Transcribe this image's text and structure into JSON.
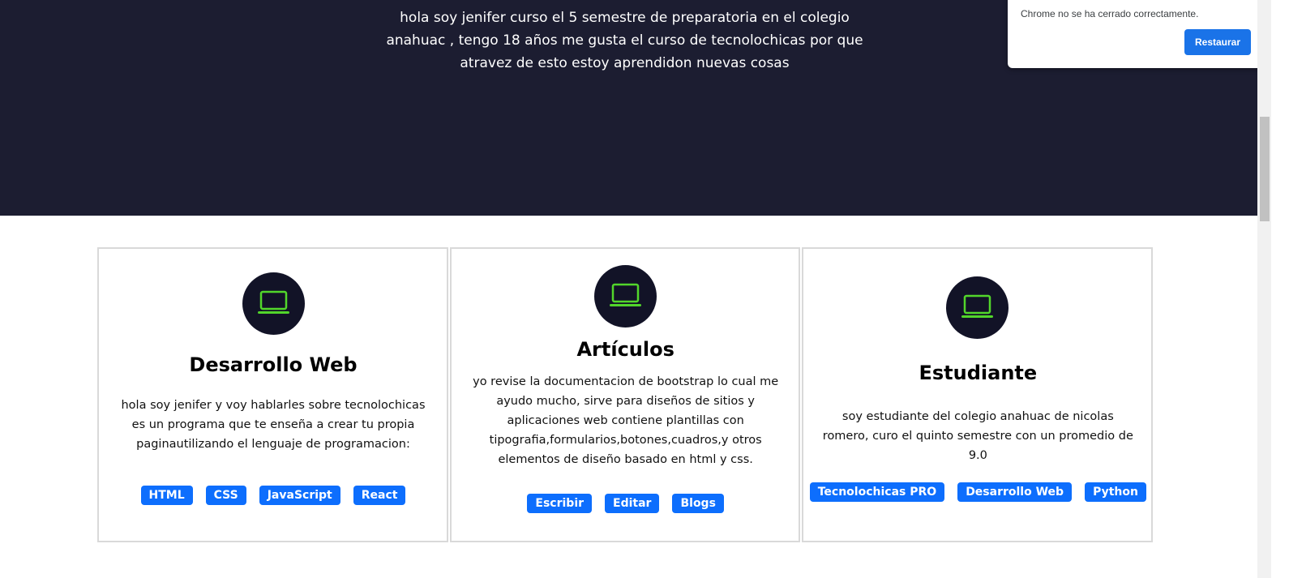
{
  "hero": {
    "intro": "hola soy jenifer curso el 5 semestre de preparatoria en el colegio anahuac , tengo 18 años me gusta el curso de tecnolochicas por que atravez de esto estoy aprendidon nuevas cosas"
  },
  "toast": {
    "message": "Chrome no se ha cerrado correctamente.",
    "button": "Restaurar"
  },
  "accent_color": "#0d6efd",
  "icon_color": "#52d62b",
  "cards": [
    {
      "icon": "laptop-icon",
      "title": "Desarrollo Web",
      "text": "hola soy jenifer y voy hablarles sobre tecnolochicas es un programa que te enseña a crear tu propia paginautilizando el lenguaje de programacion:",
      "badges": [
        "HTML",
        "CSS",
        "JavaScript",
        "React"
      ]
    },
    {
      "icon": "laptop-icon",
      "title": "Artículos",
      "text": "yo revise la documentacion de bootstrap lo cual me ayudo mucho, sirve para diseños de sitios y aplicaciones web contiene plantillas con tipografia,formularios,botones,cuadros,y otros elementos de diseño basado en html y css.",
      "badges": [
        "Escribir",
        "Editar",
        "Blogs"
      ]
    },
    {
      "icon": "laptop-icon",
      "title": "Estudiante",
      "text": "soy estudiante del colegio anahuac de nicolas romero, curo el quinto semestre con un promedio de 9.0",
      "badges": [
        "Tecnolochicas PRO",
        "Desarrollo Web",
        "Python"
      ]
    }
  ]
}
